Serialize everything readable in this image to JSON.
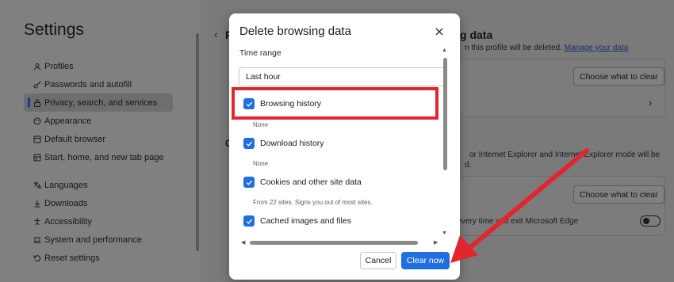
{
  "sidebar": {
    "title": "Settings",
    "items": [
      {
        "label": "Profiles",
        "icon": "profile-icon"
      },
      {
        "label": "Passwords and autofill",
        "icon": "key-icon"
      },
      {
        "label": "Privacy, search, and services",
        "icon": "lock-icon",
        "active": true
      },
      {
        "label": "Appearance",
        "icon": "palette-icon"
      },
      {
        "label": "Default browser",
        "icon": "browser-icon"
      },
      {
        "label": "Start, home, and new tab page",
        "icon": "home-icon"
      },
      {
        "label": "Languages",
        "icon": "language-icon"
      },
      {
        "label": "Downloads",
        "icon": "download-icon"
      },
      {
        "label": "Accessibility",
        "icon": "accessibility-icon"
      },
      {
        "label": "System and performance",
        "icon": "laptop-icon"
      },
      {
        "label": "Reset settings",
        "icon": "reset-icon"
      }
    ]
  },
  "background": {
    "section_heading_tail": "g data",
    "section_desc_tail": "n this profile will be deleted.",
    "manage_link": "Manage your data",
    "choose_btn_1": "Choose what to clear",
    "ie_text_1": "or Internet Explorer and Internet Explorer mode will be",
    "ie_text_2": "d.",
    "choose_btn_2": "Choose what to clear",
    "exit_text": "e every time you exit Microsoft Edge",
    "heading_initial": "C",
    "back_letter": "P"
  },
  "modal": {
    "title": "Delete browsing data",
    "time_range_label": "Time range",
    "time_range_value": "Last hour",
    "options": [
      {
        "label": "Browsing history",
        "desc": "None"
      },
      {
        "label": "Download history",
        "desc": "None"
      },
      {
        "label": "Cookies and other site data",
        "desc": "From 22 sites. Signs you out of most sites."
      },
      {
        "label": "Cached images and files",
        "desc": ""
      }
    ],
    "cancel_label": "Cancel",
    "clear_label": "Clear now"
  },
  "colors": {
    "accent": "#1f6fe0",
    "annotation_red": "#e2262f"
  }
}
